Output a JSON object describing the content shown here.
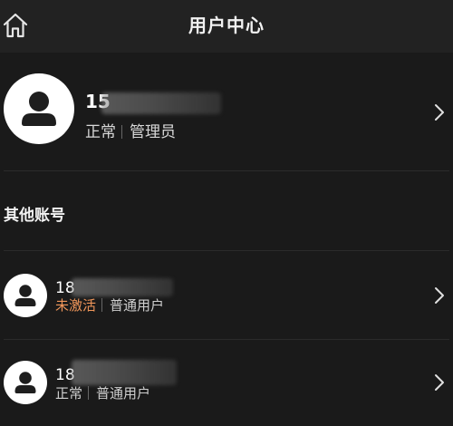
{
  "header": {
    "title": "用户中心",
    "home_icon": "home-icon"
  },
  "current_account": {
    "phone_visible": "15",
    "status": "正常",
    "role": "管理员",
    "avatar_icon": "user-avatar-icon",
    "chevron_icon": "chevron-right-icon"
  },
  "other_accounts": {
    "title": "其他账号",
    "items": [
      {
        "phone_visible": "18",
        "status": "未激活",
        "status_color": "#f0965a",
        "role": "普通用户"
      },
      {
        "phone_visible": "18",
        "status": "正常",
        "status_color": "#cfcfcf",
        "role": "普通用户"
      }
    ]
  },
  "colors": {
    "background": "#1a1a1a",
    "header_bg": "#222222",
    "inactive_status": "#f0965a"
  }
}
